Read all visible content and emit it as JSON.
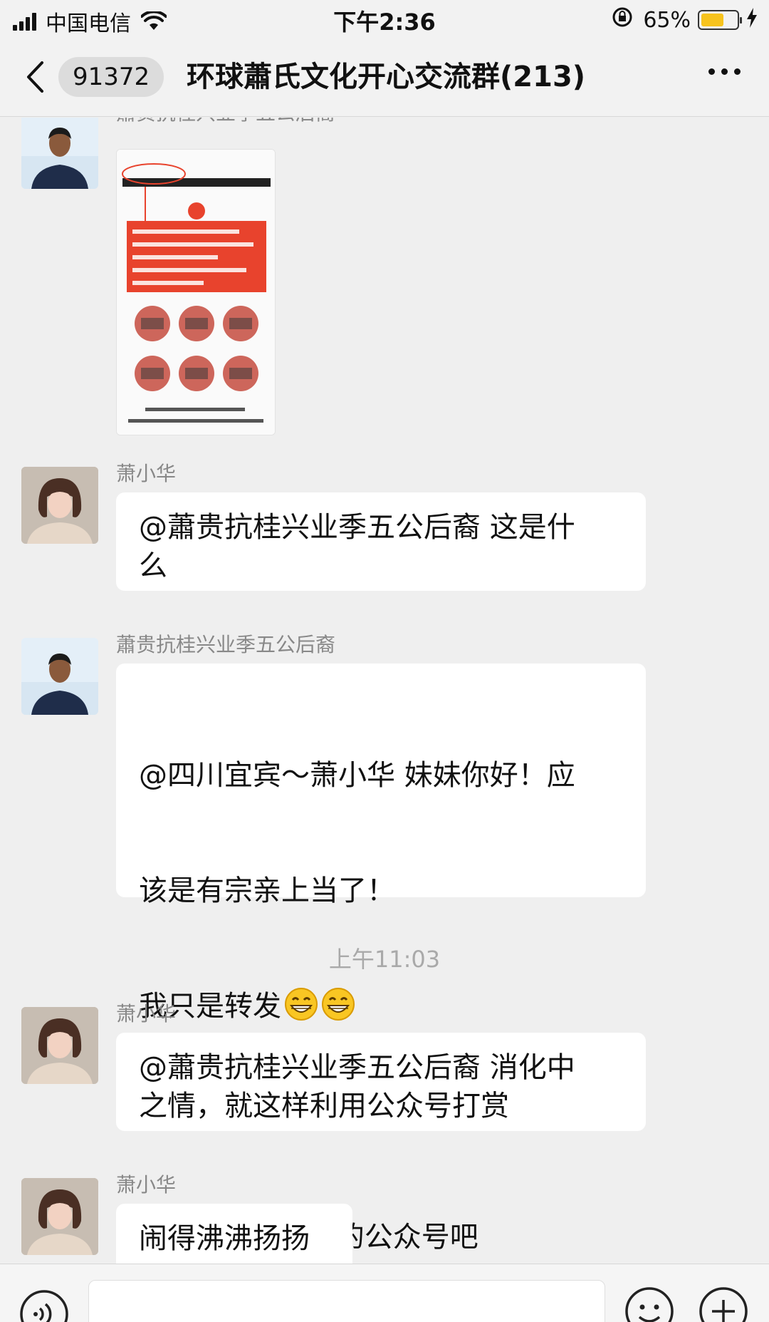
{
  "status_bar": {
    "carrier": "中国电信",
    "time": "下午2:36",
    "battery_percent": "65%",
    "battery_level": 0.65,
    "battery_color": "#f7c31d"
  },
  "nav": {
    "unread_count": "91372",
    "title": "环球蕭氏文化开心交流群(213)",
    "icons": [
      "chevron-left-icon",
      "more-icon"
    ]
  },
  "messages": [
    {
      "sender": "蕭贵抗桂兴业季五公后裔",
      "type": "image",
      "avatar": "avatar-man"
    },
    {
      "sender": "萧小华",
      "type": "text",
      "text": "@蕭贵抗桂兴业季五公后裔 这是什\n么",
      "avatar": "avatar-woman"
    },
    {
      "sender": "蕭贵抗桂兴业季五公后裔",
      "type": "text",
      "text_lines": [
        "@四川宜宾～萧小华 妹妹你好！应",
        "该是有宗亲上当了！",
        "我只是转发",
        "",
        "应该是\"消化中\"的公众号吧"
      ],
      "emoji": "grinning-emoji",
      "avatar": "avatar-man"
    },
    {
      "type": "time",
      "text": "上午11:03"
    },
    {
      "sender": "萧小华",
      "type": "text",
      "text": "@蕭贵抗桂兴业季五公后裔 消化中\n之情，就这样利用公众号打赏",
      "avatar": "avatar-woman"
    },
    {
      "sender": "萧小华",
      "type": "text",
      "text": "闹得沸沸扬扬",
      "avatar": "avatar-woman"
    }
  ],
  "input_bar": {
    "icons": [
      "voice-icon",
      "emoji-icon",
      "plus-icon"
    ]
  },
  "colors": {
    "background": "#efefef",
    "bubble": "#ffffff",
    "shared_image_accent": "#e8432d"
  }
}
